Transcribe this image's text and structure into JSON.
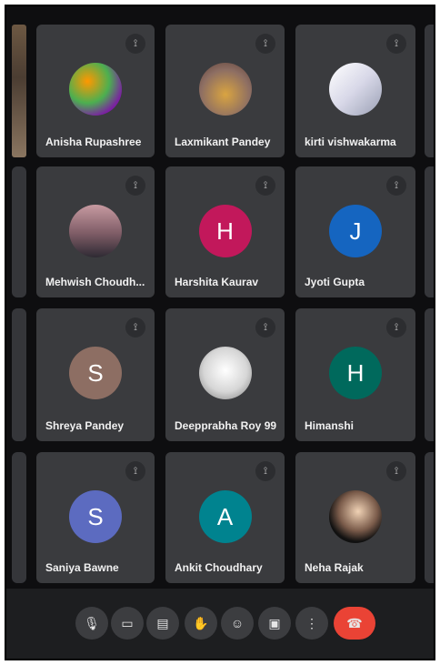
{
  "participants": [
    {
      "name": "Anisha Rupashree",
      "initial": "",
      "mic_icon": "mic-off-icon",
      "avatar_type": "photo",
      "avatar_color": "#f4b400"
    },
    {
      "name": "Laxmikant Pandey",
      "initial": "",
      "mic_icon": "mic-off-icon",
      "avatar_type": "photo",
      "avatar_color": "#d9a441"
    },
    {
      "name": "kirti vishwakarma",
      "initial": "",
      "mic_icon": "mic-off-icon",
      "avatar_type": "photo",
      "avatar_color": "#d8d8e8"
    },
    {
      "name": "Mehwish Choudh...",
      "initial": "",
      "mic_icon": "mic-off-icon",
      "avatar_type": "photo",
      "avatar_color": "#7e5c66"
    },
    {
      "name": "Harshita Kaurav",
      "initial": "H",
      "mic_icon": "mic-off-icon",
      "avatar_type": "letter",
      "avatar_color": "#c2185b"
    },
    {
      "name": "Jyoti Gupta",
      "initial": "J",
      "mic_icon": "mic-off-icon",
      "avatar_type": "letter",
      "avatar_color": "#1565c0"
    },
    {
      "name": "Shreya Pandey",
      "initial": "S",
      "mic_icon": "mic-off-icon",
      "avatar_type": "letter",
      "avatar_color": "#8d6e63"
    },
    {
      "name": "Deepprabha Roy 99",
      "initial": "",
      "mic_icon": "mic-off-icon",
      "avatar_type": "photo",
      "avatar_color": "#e0e0e0"
    },
    {
      "name": "Himanshi",
      "initial": "H",
      "mic_icon": "mic-off-icon",
      "avatar_type": "letter",
      "avatar_color": "#00695c"
    },
    {
      "name": "Saniya Bawne",
      "initial": "S",
      "mic_icon": "mic-off-icon",
      "avatar_type": "letter",
      "avatar_color": "#5c6bc0"
    },
    {
      "name": "Ankit Choudhary",
      "initial": "A",
      "mic_icon": "mic-off-icon",
      "avatar_type": "letter",
      "avatar_color": "#00838f"
    },
    {
      "name": "Neha Rajak",
      "initial": "",
      "mic_icon": "mic-off-icon",
      "avatar_type": "photo",
      "avatar_color": "#2b2b2b"
    }
  ],
  "toolbar": {
    "buttons": [
      {
        "name": "mic-button",
        "icon": "mic-icon",
        "glyph": "🎙"
      },
      {
        "name": "camera-button",
        "icon": "camera-icon",
        "glyph": "▭"
      },
      {
        "name": "captions-button",
        "icon": "captions-icon",
        "glyph": "▤"
      },
      {
        "name": "raise-hand-button",
        "icon": "hand-icon",
        "glyph": "✋"
      },
      {
        "name": "reactions-button",
        "icon": "emoji-icon",
        "glyph": "☺"
      },
      {
        "name": "present-button",
        "icon": "present-icon",
        "glyph": "▣"
      },
      {
        "name": "more-options-button",
        "icon": "more-vertical-icon",
        "glyph": "⋮"
      },
      {
        "name": "leave-call-button",
        "icon": "hang-up-icon",
        "glyph": "☎"
      }
    ],
    "colors": {
      "end_call": "#ea4335"
    }
  }
}
